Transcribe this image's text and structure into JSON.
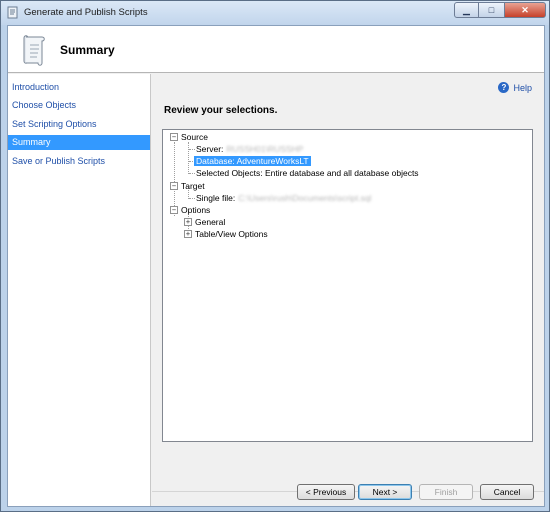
{
  "window": {
    "title": "Generate and Publish Scripts"
  },
  "header": {
    "title": "Summary"
  },
  "sidebar": {
    "items": [
      {
        "label": "Introduction"
      },
      {
        "label": "Choose Objects"
      },
      {
        "label": "Set Scripting Options"
      },
      {
        "label": "Summary",
        "selected": true
      },
      {
        "label": "Save or Publish Scripts"
      }
    ]
  },
  "main": {
    "help_label": "Help",
    "review_label": "Review your selections.",
    "tree": {
      "source": "Source",
      "server_label": "Server:",
      "server_value": "RUSSH01\\RUSSHP",
      "database": "Database: AdventureWorksLT",
      "selected_objects": "Selected Objects: Entire database and all database objects",
      "target": "Target",
      "single_file_label": "Single file:",
      "single_file_value": "C:\\Users\\rush\\Documents\\script.sql",
      "options": "Options",
      "general": "General",
      "table_view_options": "Table/View Options"
    }
  },
  "buttons": {
    "previous": "< Previous",
    "next": "Next >",
    "finish": "Finish",
    "cancel": "Cancel"
  },
  "colors": {
    "selection": "#3399ff",
    "link": "#1f4fa8"
  }
}
